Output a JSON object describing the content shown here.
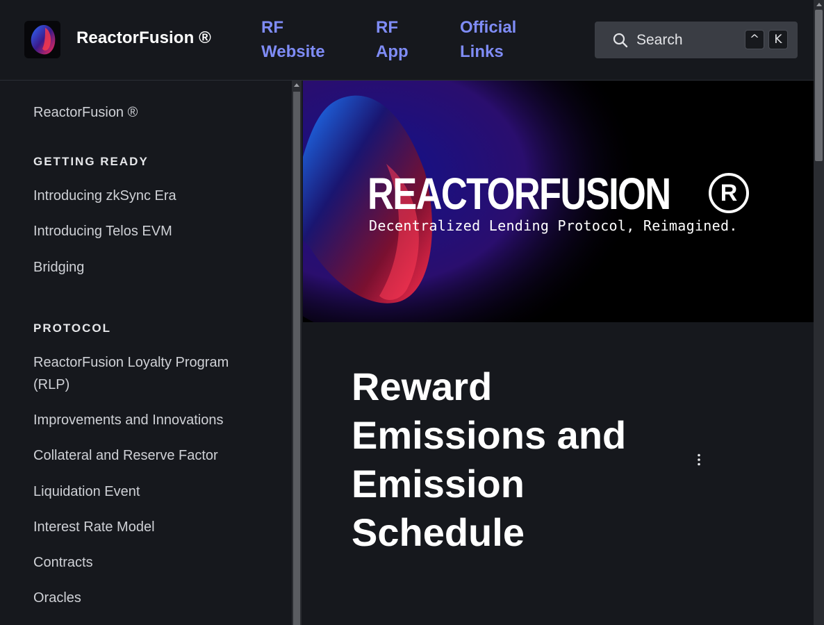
{
  "header": {
    "brand": "ReactorFusion ®",
    "nav": [
      {
        "label": "RF Website"
      },
      {
        "label": "RF App"
      },
      {
        "label": "Official Links"
      }
    ],
    "search": {
      "label": "Search",
      "keys": [
        "^",
        "K"
      ]
    }
  },
  "sidebar": {
    "top_item": "ReactorFusion ®",
    "sections": [
      {
        "heading": "GETTING READY",
        "items": [
          "Introducing zkSync Era",
          "Introducing Telos EVM",
          "Bridging"
        ]
      },
      {
        "heading": "PROTOCOL",
        "items": [
          "ReactorFusion Loyalty Program (RLP)",
          "Improvements and Innovations",
          "Collateral and Reserve Factor",
          "Liquidation Event",
          "Interest Rate Model",
          "Contracts",
          "Oracles"
        ]
      }
    ]
  },
  "main": {
    "hero": {
      "title": "REACTORFUSION",
      "reg_mark": "R",
      "subtitle": "Decentralized Lending Protocol, Reimagined."
    },
    "page_title": "Reward Emissions and Emission Schedule"
  },
  "icons": {
    "search": "search-icon",
    "more": "more-vertical-icon",
    "logo": "reactorfusion-logo-icon"
  },
  "colors": {
    "background": "#16181d",
    "link": "#7f8cf6",
    "search_bg": "#3a3d44"
  }
}
